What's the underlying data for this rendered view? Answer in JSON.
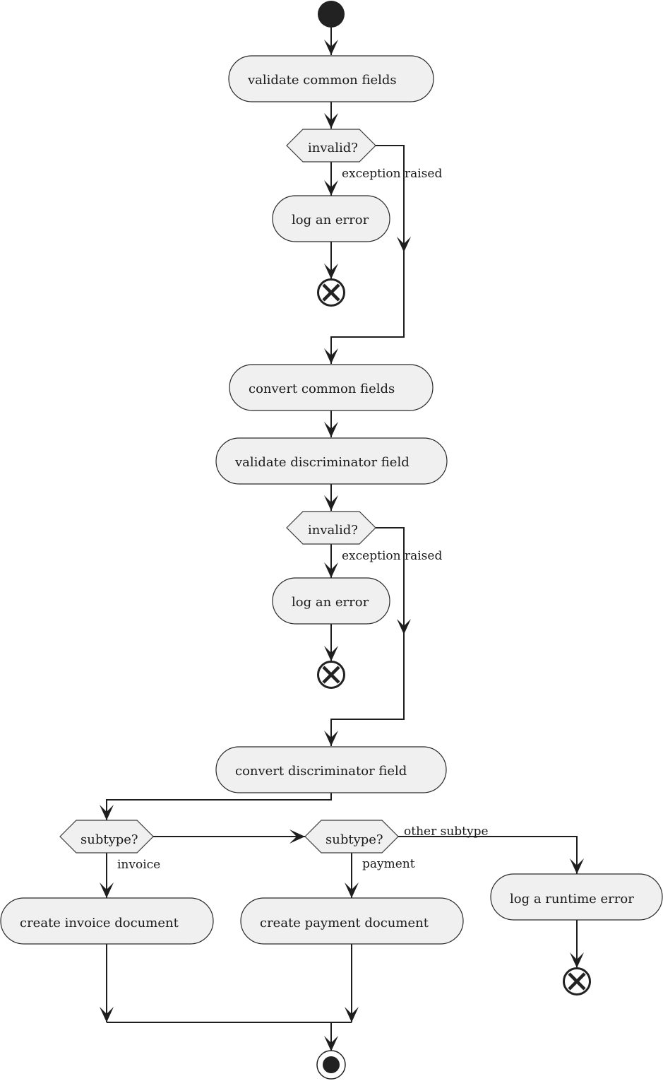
{
  "diagram": {
    "type": "activity",
    "colors": {
      "node_fill": "#f0f0f0",
      "stroke": "#1e1e1e",
      "start_fill": "#222222"
    },
    "nodes": {
      "start": {
        "kind": "start"
      },
      "validate_common": {
        "kind": "action",
        "label": "validate common fields"
      },
      "invalid_1": {
        "kind": "decision",
        "label": "invalid?"
      },
      "log_error_1": {
        "kind": "action",
        "label": "log an error"
      },
      "stop_1": {
        "kind": "flow-final"
      },
      "convert_common": {
        "kind": "action",
        "label": "convert common fields"
      },
      "validate_discriminator": {
        "kind": "action",
        "label": "validate discriminator field"
      },
      "invalid_2": {
        "kind": "decision",
        "label": "invalid?"
      },
      "log_error_2": {
        "kind": "action",
        "label": "log an error"
      },
      "stop_2": {
        "kind": "flow-final"
      },
      "convert_discriminator": {
        "kind": "action",
        "label": "convert discriminator field"
      },
      "subtype_1": {
        "kind": "decision",
        "label": "subtype?"
      },
      "subtype_2": {
        "kind": "decision",
        "label": "subtype?"
      },
      "create_invoice": {
        "kind": "action",
        "label": "create invoice document"
      },
      "create_payment": {
        "kind": "action",
        "label": "create payment document"
      },
      "log_runtime": {
        "kind": "action",
        "label": "log a runtime error"
      },
      "stop_3": {
        "kind": "flow-final"
      },
      "end": {
        "kind": "end"
      }
    },
    "edge_labels": {
      "exception_1": "exception raised",
      "exception_2": "exception raised",
      "invoice": "invoice",
      "payment": "payment",
      "other": "other subtype"
    }
  }
}
